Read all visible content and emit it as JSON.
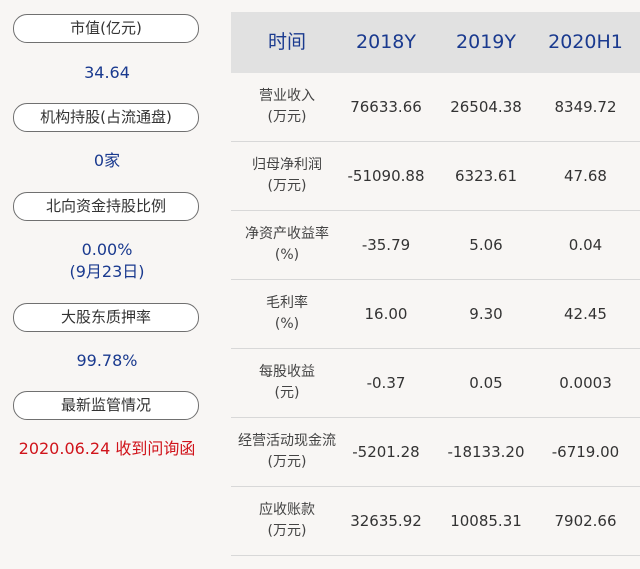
{
  "left": {
    "blocks": [
      {
        "label": "市值(亿元)",
        "value": "34.64"
      },
      {
        "label": "机构持股(占流通盘)",
        "value": "0家"
      },
      {
        "label": "北向资金持股比例",
        "value": "0.00%",
        "value2": "(9月23日)"
      },
      {
        "label": "大股东质押率",
        "value": "99.78%"
      },
      {
        "label": "最新监管情况",
        "value": "2020.06.24 收到问询函"
      }
    ]
  },
  "table": {
    "headers": [
      "时间",
      "2018Y",
      "2019Y",
      "2020H1"
    ],
    "rows": [
      {
        "name": "营业收入",
        "unit": "(万元)",
        "values": [
          "76633.66",
          "26504.38",
          "8349.72"
        ]
      },
      {
        "name": "归母净利润",
        "unit": "(万元)",
        "values": [
          "-51090.88",
          "6323.61",
          "47.68"
        ]
      },
      {
        "name": "净资产收益率",
        "unit": "(%)",
        "values": [
          "-35.79",
          "5.06",
          "0.04"
        ]
      },
      {
        "name": "毛利率",
        "unit": "(%)",
        "values": [
          "16.00",
          "9.30",
          "42.45"
        ]
      },
      {
        "name": "每股收益",
        "unit": "(元)",
        "values": [
          "-0.37",
          "0.05",
          "0.0003"
        ]
      },
      {
        "name": "经营活动现金流",
        "unit": "(万元)",
        "values": [
          "-5201.28",
          "-18133.20",
          "-6719.00"
        ]
      },
      {
        "name": "应收账款",
        "unit": "(万元)",
        "values": [
          "32635.92",
          "10085.31",
          "7902.66"
        ]
      }
    ]
  },
  "colors": {
    "value_blue": "#1a3a8f",
    "alert_red": "#d0141b",
    "header_bg": "#e1e1e1",
    "page_bg": "#f8f6f4"
  }
}
